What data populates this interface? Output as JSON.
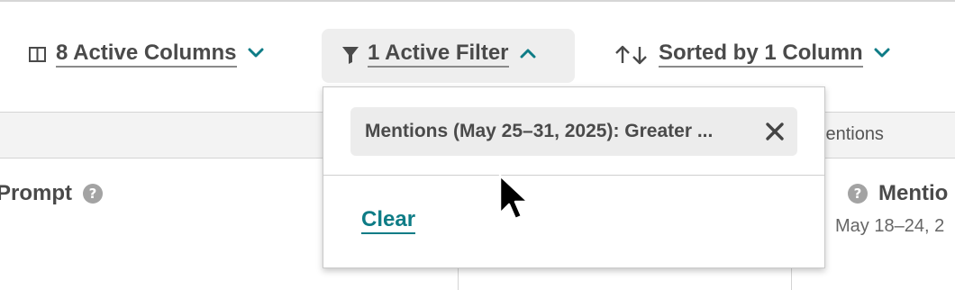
{
  "toolbar": {
    "columns": {
      "label": "8 Active Columns",
      "icon": "columns-icon"
    },
    "filter": {
      "label": "1 Active Filter",
      "icon": "filter-funnel-icon",
      "expanded": true
    },
    "sort": {
      "label": "Sorted by 1 Column",
      "icon": "sort-arrows-icon"
    }
  },
  "table": {
    "header_partial": "lentions",
    "prompt_header": "Prompt",
    "prompt_help": "?",
    "mentions_header": "Mentio",
    "mentions_help": "?",
    "mentions_date": "May 18–24, 2"
  },
  "filter_dropdown": {
    "chip_text": "Mentions (May 25–31, 2025): Greater ...",
    "clear_label": "Clear"
  },
  "colors": {
    "accent": "#0e7c86",
    "text": "#4a4a4a",
    "muted": "#8a8a8a"
  }
}
